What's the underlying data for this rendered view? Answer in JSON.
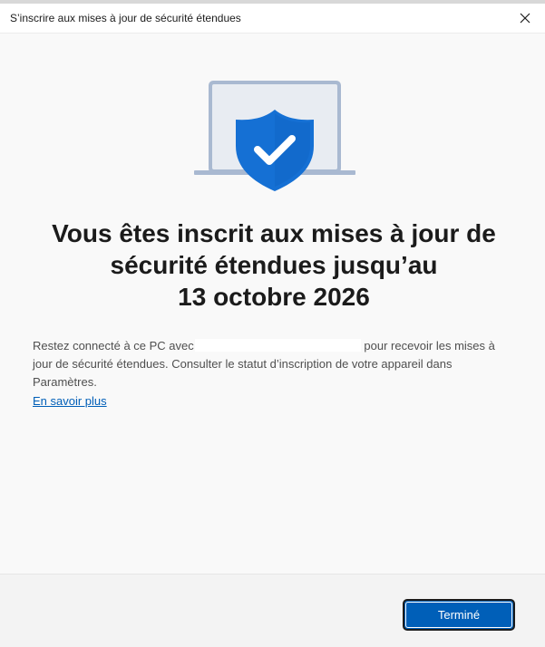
{
  "window": {
    "title": "S’inscrire aux mises à jour de sécurité étendues",
    "close_icon": "close-icon"
  },
  "hero": {
    "icon": "laptop-shield-check-icon",
    "colors": {
      "shield": "#1570d4",
      "laptop": "#a9b9d1",
      "screen": "#e8ecf2",
      "check": "#ffffff"
    }
  },
  "headline": {
    "line1": "Vous êtes inscrit aux mises à jour de",
    "line2": "sécurité étendues jusqu’au",
    "line3": "13 octobre 2026"
  },
  "body": {
    "text_before": "Restez connecté à ce PC avec",
    "text_after": " pour recevoir les mises à jour de sécurité étendues. Consulter le statut d’inscription de votre appareil dans Paramètres.",
    "learn_more": "En savoir plus"
  },
  "footer": {
    "done_label": "Terminé"
  },
  "colors": {
    "accent": "#005fb8",
    "link": "#005fb8",
    "background": "#f9f9f9"
  }
}
